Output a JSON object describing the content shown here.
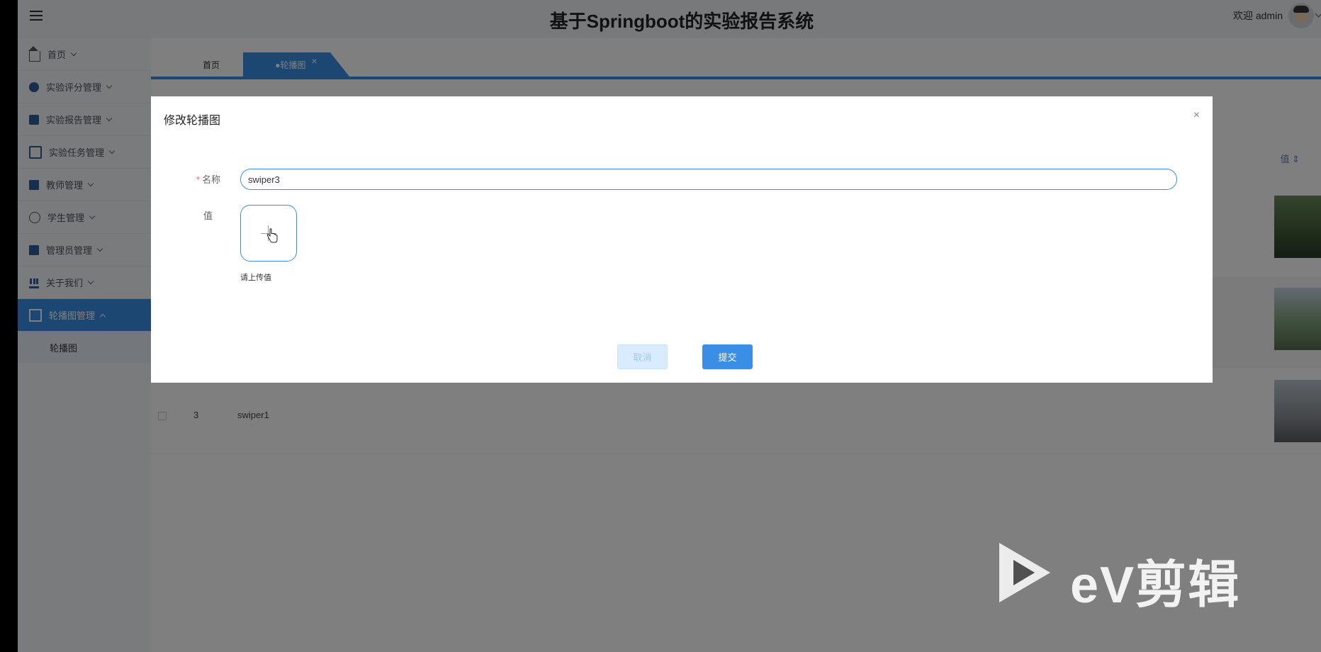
{
  "header": {
    "title": "基于Springboot的实验报告系统",
    "welcome": "欢迎 admin"
  },
  "sidebar": {
    "items": [
      {
        "label": "首页",
        "icon": "home-icon"
      },
      {
        "label": "实验评分管理",
        "icon": "circle-icon"
      },
      {
        "label": "实验报告管理",
        "icon": "book-icon"
      },
      {
        "label": "实验任务管理",
        "icon": "chip-icon"
      },
      {
        "label": "教师管理",
        "icon": "card-icon"
      },
      {
        "label": "学生管理",
        "icon": "user-icon"
      },
      {
        "label": "管理员管理",
        "icon": "gift-icon"
      },
      {
        "label": "关于我们",
        "icon": "bank-icon"
      },
      {
        "label": "轮播图管理",
        "icon": "table-icon"
      }
    ],
    "submenu": {
      "label": "轮播图"
    }
  },
  "tabs": {
    "home": "首页",
    "active": "●轮播图",
    "close": "×"
  },
  "table": {
    "value_header": "值 ⇕",
    "row3": {
      "index": "3",
      "name": "swiper1"
    }
  },
  "dialog": {
    "title": "修改轮播图",
    "close": "×",
    "required_mark": "*",
    "name_label": "名称",
    "name_value": "swiper3",
    "value_label": "值",
    "upload_tip": "请上传值",
    "cancel_label": "取消",
    "submit_label": "提交"
  },
  "watermark": {
    "text": "eV剪辑"
  },
  "colors": {
    "accent": "#3a8ee6",
    "overlay": "rgba(0,0,0,0.5)"
  }
}
